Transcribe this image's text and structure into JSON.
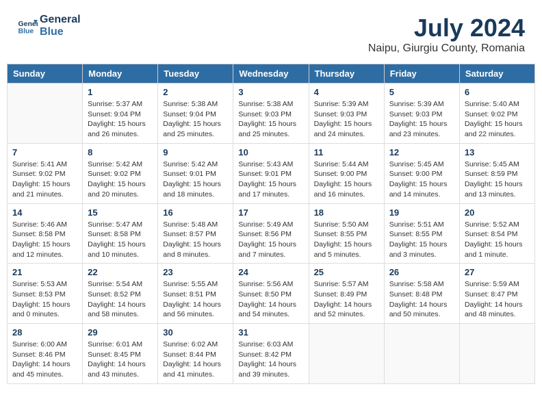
{
  "header": {
    "logo_line1": "General",
    "logo_line2": "Blue",
    "month_title": "July 2024",
    "subtitle": "Naipu, Giurgiu County, Romania"
  },
  "days_of_week": [
    "Sunday",
    "Monday",
    "Tuesday",
    "Wednesday",
    "Thursday",
    "Friday",
    "Saturday"
  ],
  "weeks": [
    [
      {
        "day": "",
        "info": ""
      },
      {
        "day": "1",
        "info": "Sunrise: 5:37 AM\nSunset: 9:04 PM\nDaylight: 15 hours\nand 26 minutes."
      },
      {
        "day": "2",
        "info": "Sunrise: 5:38 AM\nSunset: 9:04 PM\nDaylight: 15 hours\nand 25 minutes."
      },
      {
        "day": "3",
        "info": "Sunrise: 5:38 AM\nSunset: 9:03 PM\nDaylight: 15 hours\nand 25 minutes."
      },
      {
        "day": "4",
        "info": "Sunrise: 5:39 AM\nSunset: 9:03 PM\nDaylight: 15 hours\nand 24 minutes."
      },
      {
        "day": "5",
        "info": "Sunrise: 5:39 AM\nSunset: 9:03 PM\nDaylight: 15 hours\nand 23 minutes."
      },
      {
        "day": "6",
        "info": "Sunrise: 5:40 AM\nSunset: 9:02 PM\nDaylight: 15 hours\nand 22 minutes."
      }
    ],
    [
      {
        "day": "7",
        "info": "Sunrise: 5:41 AM\nSunset: 9:02 PM\nDaylight: 15 hours\nand 21 minutes."
      },
      {
        "day": "8",
        "info": "Sunrise: 5:42 AM\nSunset: 9:02 PM\nDaylight: 15 hours\nand 20 minutes."
      },
      {
        "day": "9",
        "info": "Sunrise: 5:42 AM\nSunset: 9:01 PM\nDaylight: 15 hours\nand 18 minutes."
      },
      {
        "day": "10",
        "info": "Sunrise: 5:43 AM\nSunset: 9:01 PM\nDaylight: 15 hours\nand 17 minutes."
      },
      {
        "day": "11",
        "info": "Sunrise: 5:44 AM\nSunset: 9:00 PM\nDaylight: 15 hours\nand 16 minutes."
      },
      {
        "day": "12",
        "info": "Sunrise: 5:45 AM\nSunset: 9:00 PM\nDaylight: 15 hours\nand 14 minutes."
      },
      {
        "day": "13",
        "info": "Sunrise: 5:45 AM\nSunset: 8:59 PM\nDaylight: 15 hours\nand 13 minutes."
      }
    ],
    [
      {
        "day": "14",
        "info": "Sunrise: 5:46 AM\nSunset: 8:58 PM\nDaylight: 15 hours\nand 12 minutes."
      },
      {
        "day": "15",
        "info": "Sunrise: 5:47 AM\nSunset: 8:58 PM\nDaylight: 15 hours\nand 10 minutes."
      },
      {
        "day": "16",
        "info": "Sunrise: 5:48 AM\nSunset: 8:57 PM\nDaylight: 15 hours\nand 8 minutes."
      },
      {
        "day": "17",
        "info": "Sunrise: 5:49 AM\nSunset: 8:56 PM\nDaylight: 15 hours\nand 7 minutes."
      },
      {
        "day": "18",
        "info": "Sunrise: 5:50 AM\nSunset: 8:55 PM\nDaylight: 15 hours\nand 5 minutes."
      },
      {
        "day": "19",
        "info": "Sunrise: 5:51 AM\nSunset: 8:55 PM\nDaylight: 15 hours\nand 3 minutes."
      },
      {
        "day": "20",
        "info": "Sunrise: 5:52 AM\nSunset: 8:54 PM\nDaylight: 15 hours\nand 1 minute."
      }
    ],
    [
      {
        "day": "21",
        "info": "Sunrise: 5:53 AM\nSunset: 8:53 PM\nDaylight: 15 hours\nand 0 minutes."
      },
      {
        "day": "22",
        "info": "Sunrise: 5:54 AM\nSunset: 8:52 PM\nDaylight: 14 hours\nand 58 minutes."
      },
      {
        "day": "23",
        "info": "Sunrise: 5:55 AM\nSunset: 8:51 PM\nDaylight: 14 hours\nand 56 minutes."
      },
      {
        "day": "24",
        "info": "Sunrise: 5:56 AM\nSunset: 8:50 PM\nDaylight: 14 hours\nand 54 minutes."
      },
      {
        "day": "25",
        "info": "Sunrise: 5:57 AM\nSunset: 8:49 PM\nDaylight: 14 hours\nand 52 minutes."
      },
      {
        "day": "26",
        "info": "Sunrise: 5:58 AM\nSunset: 8:48 PM\nDaylight: 14 hours\nand 50 minutes."
      },
      {
        "day": "27",
        "info": "Sunrise: 5:59 AM\nSunset: 8:47 PM\nDaylight: 14 hours\nand 48 minutes."
      }
    ],
    [
      {
        "day": "28",
        "info": "Sunrise: 6:00 AM\nSunset: 8:46 PM\nDaylight: 14 hours\nand 45 minutes."
      },
      {
        "day": "29",
        "info": "Sunrise: 6:01 AM\nSunset: 8:45 PM\nDaylight: 14 hours\nand 43 minutes."
      },
      {
        "day": "30",
        "info": "Sunrise: 6:02 AM\nSunset: 8:44 PM\nDaylight: 14 hours\nand 41 minutes."
      },
      {
        "day": "31",
        "info": "Sunrise: 6:03 AM\nSunset: 8:42 PM\nDaylight: 14 hours\nand 39 minutes."
      },
      {
        "day": "",
        "info": ""
      },
      {
        "day": "",
        "info": ""
      },
      {
        "day": "",
        "info": ""
      }
    ]
  ]
}
